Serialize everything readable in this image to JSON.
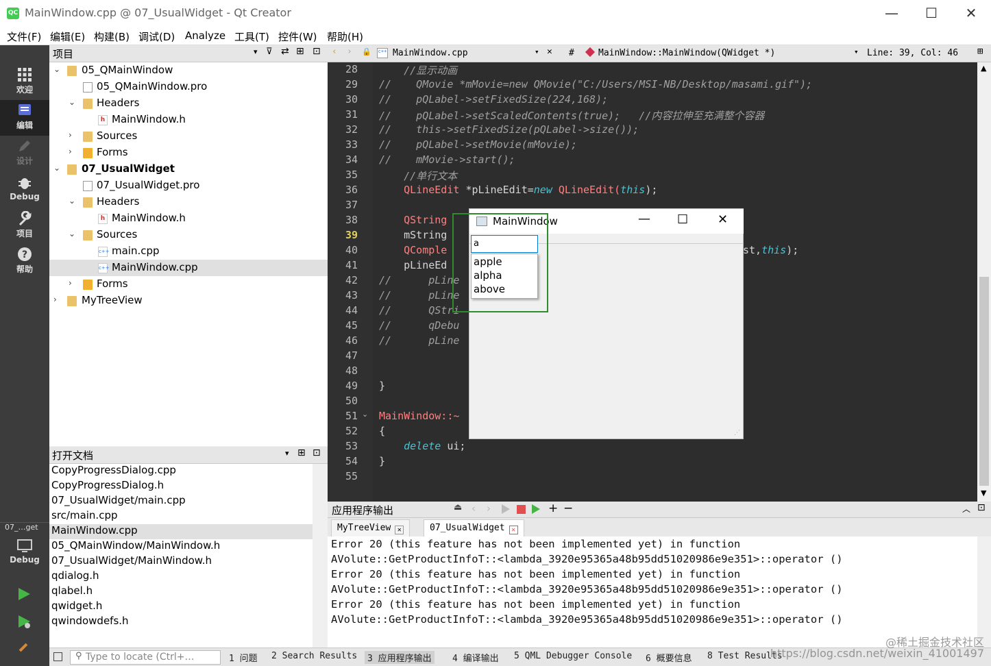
{
  "window": {
    "title": "MainWindow.cpp @ 07_UsualWidget - Qt Creator",
    "app_icon": "QC"
  },
  "menu": [
    "文件(F)",
    "编辑(E)",
    "构建(B)",
    "调试(D)",
    "Analyze",
    "工具(T)",
    "控件(W)",
    "帮助(H)"
  ],
  "modes": {
    "welcome": "欢迎",
    "edit": "编辑",
    "design": "设计",
    "debug": "Debug",
    "projects": "项目",
    "help": "帮助"
  },
  "kit": {
    "label": "07_…get",
    "mode": "Debug"
  },
  "project_pane": {
    "title": "项目"
  },
  "tree": [
    {
      "label": "05_QMainWindow",
      "bold": false
    },
    {
      "label": "05_QMainWindow.pro"
    },
    {
      "label": "Headers"
    },
    {
      "label": "MainWindow.h"
    },
    {
      "label": "Sources"
    },
    {
      "label": "Forms"
    },
    {
      "label": "07_UsualWidget"
    },
    {
      "label": "07_UsualWidget.pro"
    },
    {
      "label": "Headers"
    },
    {
      "label": "MainWindow.h"
    },
    {
      "label": "Sources"
    },
    {
      "label": "main.cpp"
    },
    {
      "label": "MainWindow.cpp"
    },
    {
      "label": "Forms"
    },
    {
      "label": "MyTreeView"
    }
  ],
  "open_docs_pane": {
    "title": "打开文档"
  },
  "open_docs": [
    "CopyProgressDialog.cpp",
    "CopyProgressDialog.h",
    "07_UsualWidget/main.cpp",
    "src/main.cpp",
    "MainWindow.cpp",
    "05_QMainWindow/MainWindow.h",
    "07_UsualWidget/MainWindow.h",
    "qdialog.h",
    "qlabel.h",
    "qwidget.h",
    "qwindowdefs.h"
  ],
  "editor": {
    "file": "MainWindow.cpp",
    "symbol": "MainWindow::MainWindow(QWidget *)",
    "hash": "#",
    "position": "Line: 39, Col: 46",
    "line_numbers": [
      "28",
      "29",
      "30",
      "31",
      "32",
      "33",
      "34",
      "35",
      "36",
      "37",
      "38",
      "39",
      "40",
      "41",
      "42",
      "43",
      "44",
      "45",
      "46",
      "47",
      "48",
      "49",
      "50",
      "51",
      "52",
      "53",
      "54",
      "55"
    ],
    "current_line": "39"
  },
  "code": {
    "l28": "    //显示动画",
    "l29_c": "//",
    "l29": "    QMovie *mMovie=new QMovie(\"C:/Users/MSI-NB/Desktop/masami.gif\");",
    "l30": "    pQLabel->setFixedSize(224,168);",
    "l31": "    pQLabel->setScaledContents(true);   //内容拉伸至充满整个容器",
    "l32": "    this->setFixedSize(pQLabel->size());",
    "l33": "    pQLabel->setMovie(mMovie);",
    "l34": "    mMovie->start();",
    "l35": "    //单行文本",
    "l36_type": "    QLineEdit ",
    "l36_rest": "*pLineEdit=",
    "l36_new": "new",
    "l36_cls": " QLineEdit(",
    "l36_this": "this",
    "l36_end": ");",
    "l38": "    QString",
    "l39": "    mString",
    "l40": "    QComple",
    "l40_tail_a": "st,",
    "l40_tail_this": "this",
    "l40_tail_b": ");",
    "l41": "    pLineEd",
    "l42": "      pLine",
    "l43": "      pLine",
    "l44": "      QStri",
    "l45": "      qDebu",
    "l46": "      pLine",
    "l49": "}",
    "l51": "MainWindow::~",
    "l52": "{",
    "l53_kw": "    delete",
    "l53_rest": " ui;",
    "l54": "}"
  },
  "mainwindow_demo": {
    "title": "MainWindow",
    "input_value": "a",
    "completions": [
      "apple",
      "alpha",
      "above"
    ]
  },
  "output_pane": {
    "title": "应用程序输出",
    "tabs": [
      "MyTreeView",
      "07_UsualWidget"
    ],
    "lines": [
      "Error 20 (this feature has not been implemented yet) in function",
      "AVolute::GetProductInfoT::<lambda_3920e95365a48b95dd51020986e9e351>::operator ()",
      "Error 20 (this feature has not been implemented yet) in function",
      "AVolute::GetProductInfoT::<lambda_3920e95365a48b95dd51020986e9e351>::operator ()",
      "Error 20 (this feature has not been implemented yet) in function",
      "AVolute::GetProductInfoT::<lambda_3920e95365a48b95dd51020986e9e351>::operator ()"
    ]
  },
  "status": {
    "locate_placeholder": "Type to locate (Ctrl+…",
    "tabs": [
      "1  问题",
      "2  Search Results",
      "3  应用程序输出",
      "4  编译输出",
      "5  QML Debugger Console",
      "6  概要信息",
      "8  Test Results"
    ]
  },
  "watermark": "https://blog.csdn.net/weixin_41001497",
  "watermark_cn": "@稀土掘金技术社区",
  "colors": {
    "mode_bar": "#3c3c3c",
    "editor_bg": "#2d2d2d",
    "type": "#ff8080",
    "keyword": "#45c6d6",
    "highlight_box": "#2e8b2e"
  }
}
